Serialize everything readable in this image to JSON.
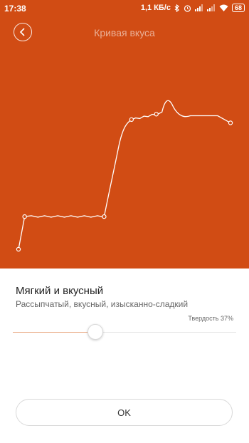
{
  "status_bar": {
    "time": "17:38",
    "speed": "1,1 КБ/с",
    "battery": "68",
    "icons": [
      "bluetooth-icon",
      "alarm-icon",
      "signal-icon",
      "signal-icon",
      "wifi-icon",
      "battery-icon"
    ]
  },
  "header": {
    "title": "Кривая вкуса",
    "back_icon": "chevron-left-icon"
  },
  "colors": {
    "accent": "#d14c14",
    "curve": "#ffffff",
    "slider_fill": "#e8a47c"
  },
  "dish": {
    "name": "Мягкий и вкусный",
    "description": "Рассыпчатый, вкусный, изысканно-сладкий"
  },
  "hardness": {
    "label": "Твердость 37%",
    "value_percent": 37
  },
  "ok_label": "OK",
  "chart_data": {
    "type": "line",
    "title": "",
    "xlabel": "",
    "ylabel": "",
    "x": [
      0,
      2.9,
      40.4,
      53.3,
      65.0,
      100
    ],
    "y": [
      8.5,
      23.5,
      23.5,
      68.0,
      70.5,
      66.5
    ],
    "control_points": [
      0,
      1,
      2,
      3,
      4,
      5
    ],
    "grid": false
  }
}
